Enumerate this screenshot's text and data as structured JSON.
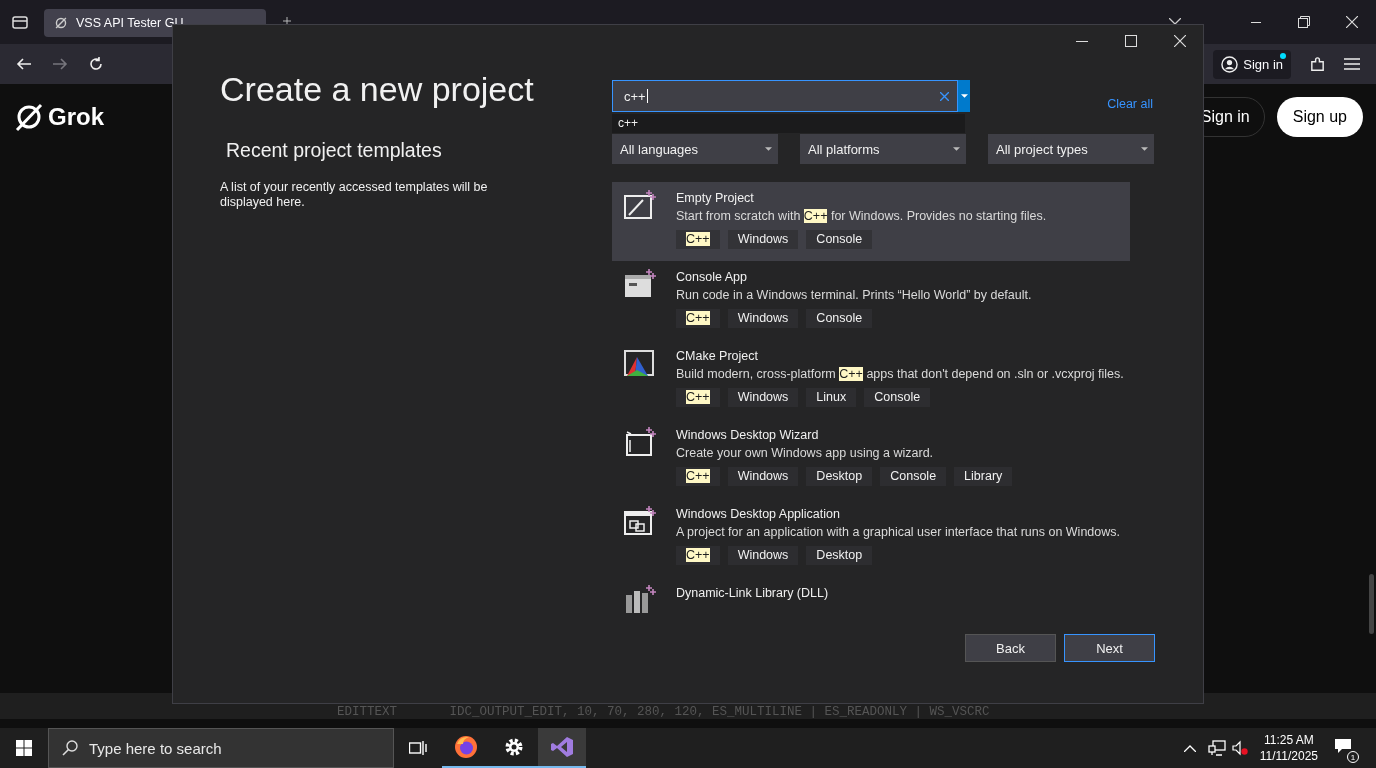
{
  "browser": {
    "tabs": [
      {
        "title": "VSS API Tester GU",
        "selected": true
      }
    ],
    "nav": [
      {
        "kind": "back",
        "disabled": false
      },
      {
        "kind": "forward",
        "disabled": true
      },
      {
        "kind": "reload",
        "disabled": false
      }
    ],
    "account": {
      "label": "Sign in",
      "notification": true
    }
  },
  "page": {
    "logo": "Grok",
    "sign_in": "Sign in",
    "sign_up": "Sign up",
    "background_code": "EDITTEXT       IDC_OUTPUT_EDIT, 10, 70, 280, 120, ES_MULTILINE | ES_READONLY | WS_VSCRC"
  },
  "dialog": {
    "title": "Create a new project",
    "recent_heading": "Recent project templates",
    "recent_text": "A list of your recently accessed templates will be displayed here.",
    "search": {
      "value": "c++",
      "suggestion": "c++"
    },
    "clear_all": "Clear all",
    "filters": [
      "All languages",
      "All platforms",
      "All project types"
    ],
    "templates": [
      {
        "kind": "empty",
        "name": "Empty Project",
        "selected": true,
        "description": [
          {
            "text": "Start from scratch with ",
            "highlighted": false
          },
          {
            "text": "C++",
            "highlighted": true
          },
          {
            "text": " for Windows. Provides no starting files.",
            "highlighted": false
          }
        ],
        "tags": [
          {
            "text": "C++",
            "highlighted": true
          },
          {
            "text": "Windows",
            "highlighted": false
          },
          {
            "text": "Console",
            "highlighted": false
          }
        ]
      },
      {
        "kind": "console",
        "name": "Console App",
        "selected": false,
        "description": [
          {
            "text": "Run code in a Windows terminal. Prints “Hello World” by default.",
            "highlighted": false
          }
        ],
        "tags": [
          {
            "text": "C++",
            "highlighted": true
          },
          {
            "text": "Windows",
            "highlighted": false
          },
          {
            "text": "Console",
            "highlighted": false
          }
        ]
      },
      {
        "kind": "cmake",
        "name": "CMake Project",
        "selected": false,
        "description": [
          {
            "text": "Build modern, cross-platform ",
            "highlighted": false
          },
          {
            "text": "C++",
            "highlighted": true
          },
          {
            "text": " apps that don't depend on .sln or .vcxproj files.",
            "highlighted": false
          }
        ],
        "tags": [
          {
            "text": "C++",
            "highlighted": true
          },
          {
            "text": "Windows",
            "highlighted": false
          },
          {
            "text": "Linux",
            "highlighted": false
          },
          {
            "text": "Console",
            "highlighted": false
          }
        ]
      },
      {
        "kind": "wizard",
        "name": "Windows Desktop Wizard",
        "selected": false,
        "description": [
          {
            "text": "Create your own Windows app using a wizard.",
            "highlighted": false
          }
        ],
        "tags": [
          {
            "text": "C++",
            "highlighted": true
          },
          {
            "text": "Windows",
            "highlighted": false
          },
          {
            "text": "Desktop",
            "highlighted": false
          },
          {
            "text": "Console",
            "highlighted": false
          },
          {
            "text": "Library",
            "highlighted": false
          }
        ]
      },
      {
        "kind": "desktop",
        "name": "Windows Desktop Application",
        "selected": false,
        "description": [
          {
            "text": "A project for an application with a graphical user interface that runs on Windows.",
            "highlighted": false
          }
        ],
        "tags": [
          {
            "text": "C++",
            "highlighted": true
          },
          {
            "text": "Windows",
            "highlighted": false
          },
          {
            "text": "Desktop",
            "highlighted": false
          }
        ]
      },
      {
        "kind": "dll",
        "name": "Dynamic-Link Library (DLL)",
        "selected": false
      }
    ],
    "buttons": [
      {
        "label": "Back",
        "primary": false
      },
      {
        "label": "Next",
        "primary": true
      }
    ]
  },
  "taskbar": {
    "search_placeholder": "Type here to search",
    "apps": [
      {
        "kind": "taskview",
        "running": false,
        "selected": false
      },
      {
        "kind": "firefox",
        "running": true,
        "selected": false
      },
      {
        "kind": "settings",
        "running": true,
        "selected": false
      },
      {
        "kind": "vs",
        "running": true,
        "selected": true
      }
    ],
    "time": "11:25 AM",
    "date": "11/11/2025",
    "notifications": "1"
  }
}
